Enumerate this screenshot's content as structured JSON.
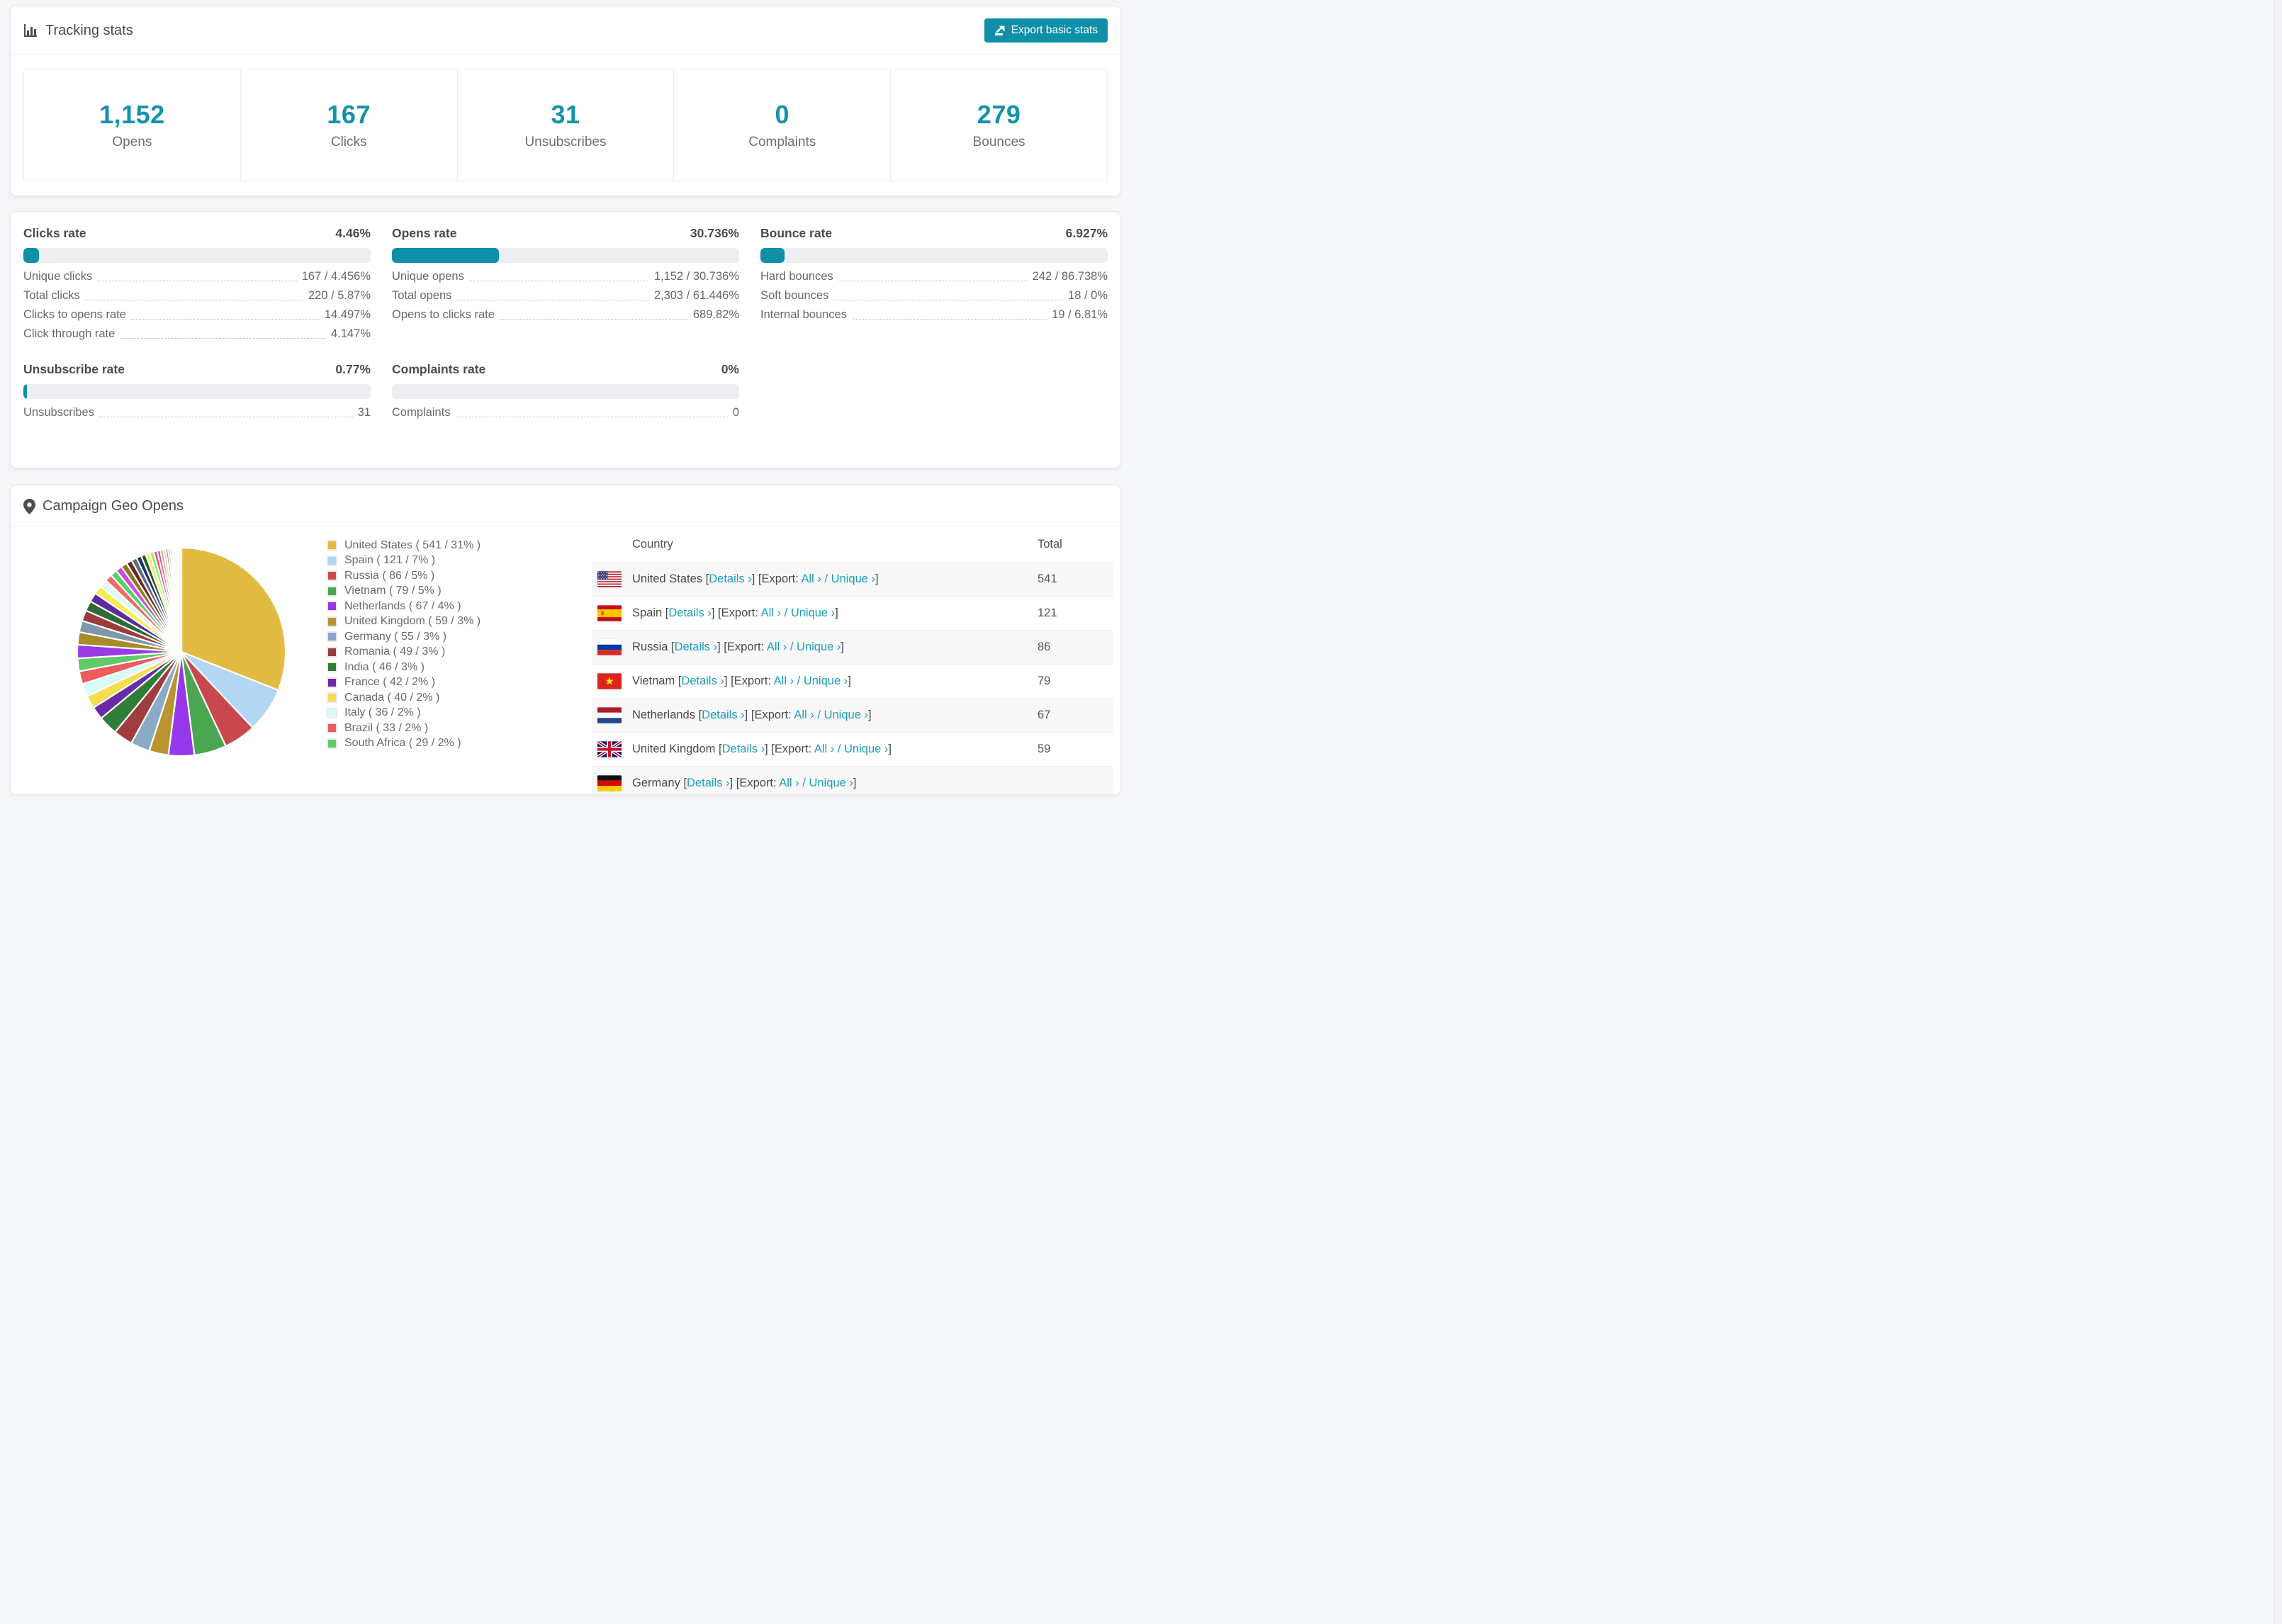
{
  "colors": {
    "accent": "#0f90a8",
    "link": "#1c9fb8",
    "bar_track": "#eceef1",
    "row_stripe": "#f8f8f8"
  },
  "tracking": {
    "title": "Tracking stats",
    "export_button": "Export basic stats",
    "stats": [
      {
        "value": "1,152",
        "label": "Opens"
      },
      {
        "value": "167",
        "label": "Clicks"
      },
      {
        "value": "31",
        "label": "Unsubscribes"
      },
      {
        "value": "0",
        "label": "Complaints"
      },
      {
        "value": "279",
        "label": "Bounces"
      }
    ]
  },
  "rates": {
    "sections": [
      {
        "title": "Clicks rate",
        "value": "4.46%",
        "percent": 4.46,
        "rows": [
          {
            "label": "Unique clicks",
            "value": "167 / 4.456%"
          },
          {
            "label": "Total clicks",
            "value": "220 / 5.87%"
          },
          {
            "label": "Clicks to opens rate",
            "value": "14.497%"
          },
          {
            "label": "Click through rate",
            "value": "4.147%"
          }
        ]
      },
      {
        "title": "Opens rate",
        "value": "30.736%",
        "percent": 30.736,
        "rows": [
          {
            "label": "Unique opens",
            "value": "1,152 / 30.736%"
          },
          {
            "label": "Total opens",
            "value": "2,303 / 61.446%"
          },
          {
            "label": "Opens to clicks rate",
            "value": "689.82%"
          }
        ]
      },
      {
        "title": "Bounce rate",
        "value": "6.927%",
        "percent": 6.927,
        "rows": [
          {
            "label": "Hard bounces",
            "value": "242 / 86.738%"
          },
          {
            "label": "Soft bounces",
            "value": "18 / 0%"
          },
          {
            "label": "Internal bounces",
            "value": "19 / 6.81%"
          }
        ]
      },
      {
        "title": "Unsubscribe rate",
        "value": "0.77%",
        "percent": 0.77,
        "rows": [
          {
            "label": "Unsubscribes",
            "value": "31"
          }
        ]
      },
      {
        "title": "Complaints rate",
        "value": "0%",
        "percent": 0,
        "rows": [
          {
            "label": "Complaints",
            "value": "0"
          }
        ]
      }
    ]
  },
  "geo": {
    "title": "Campaign Geo Opens",
    "table": {
      "headers": [
        "Country",
        "Total"
      ],
      "link_labels": {
        "details": "Details ›",
        "export_prefix": "Export:",
        "all": "All ›",
        "slash": "/",
        "unique": "Unique ›"
      },
      "rows": [
        {
          "country": "United States",
          "flag": "us",
          "total": "541"
        },
        {
          "country": "Spain",
          "flag": "es",
          "total": "121"
        },
        {
          "country": "Russia",
          "flag": "ru",
          "total": "86"
        },
        {
          "country": "Vietnam",
          "flag": "vn",
          "total": "79"
        },
        {
          "country": "Netherlands",
          "flag": "nl",
          "total": "67"
        },
        {
          "country": "United Kingdom",
          "flag": "gb",
          "total": "59"
        },
        {
          "country": "Germany",
          "flag": "de",
          "total": ""
        }
      ]
    }
  },
  "chart_data": {
    "type": "pie",
    "title": "Campaign Geo Opens",
    "legend_position": "right",
    "start_angle_deg": -90,
    "direction": "clockwise",
    "slices": [
      {
        "label": "United States",
        "count": 541,
        "percent": 31,
        "color": "#e2bc42"
      },
      {
        "label": "Spain",
        "count": 121,
        "percent": 7,
        "color": "#b3d7f2"
      },
      {
        "label": "Russia",
        "count": 86,
        "percent": 5,
        "color": "#c7494d"
      },
      {
        "label": "Vietnam",
        "count": 79,
        "percent": 5,
        "color": "#4aa650"
      },
      {
        "label": "Netherlands",
        "count": 67,
        "percent": 4,
        "color": "#9538ea"
      },
      {
        "label": "United Kingdom",
        "count": 59,
        "percent": 3,
        "color": "#b8952e"
      },
      {
        "label": "Germany",
        "count": 55,
        "percent": 3,
        "color": "#8aa9c6"
      },
      {
        "label": "Romania",
        "count": 49,
        "percent": 3,
        "color": "#9d3d40"
      },
      {
        "label": "India",
        "count": 46,
        "percent": 3,
        "color": "#2e7d38"
      },
      {
        "label": "France",
        "count": 42,
        "percent": 2,
        "color": "#6a2aa8"
      },
      {
        "label": "Canada",
        "count": 40,
        "percent": 2,
        "color": "#f6dd4d"
      },
      {
        "label": "Italy",
        "count": 36,
        "percent": 2,
        "color": "#d8fbf9"
      },
      {
        "label": "Brazil",
        "count": 33,
        "percent": 2,
        "color": "#ef5a5c"
      },
      {
        "label": "South Africa",
        "count": 29,
        "percent": 2,
        "color": "#5ecb66"
      }
    ],
    "legend_text_format": "{label} ( {count} / {percent}% )",
    "unlabeled_slices": {
      "note": "many small unlabeled countries filling the remainder of the pie",
      "percent_total": 26,
      "values": [
        1.9,
        1.75,
        1.6,
        1.5,
        1.4,
        1.3,
        1.2,
        1.1,
        1.0,
        0.95,
        0.9,
        0.85,
        0.8,
        0.75,
        0.7,
        0.65,
        0.6,
        0.55,
        0.5,
        0.45,
        0.4,
        0.36,
        0.32,
        0.28,
        0.25,
        0.22,
        0.2,
        0.17,
        0.15,
        0.13,
        0.11,
        0.1,
        0.08,
        0.07,
        0.06,
        0.05
      ],
      "colors": [
        "#9a3be8",
        "#a88c2c",
        "#7f96ab",
        "#9c3b3b",
        "#2c6b34",
        "#5e2b9e",
        "#f4ee4e",
        "#dff9f6",
        "#f56868",
        "#55d16b",
        "#d24ae0",
        "#8a7a1e",
        "#6e2525",
        "#5a6b7d",
        "#252f6e",
        "#1c5b28",
        "#f7ef55",
        "#82f08e",
        "#f54d4d",
        "#c44df0",
        "#d4a92a",
        "#a8d4f5",
        "#e84c4c",
        "#3fa34d",
        "#8a2be2",
        "#caa21f",
        "#c6f7ef",
        "#f08080",
        "#7ddc5a",
        "#e05ae0",
        "#7a3bdb",
        "#9a8c20",
        "#6b7f94",
        "#e05252",
        "#4caf50",
        "#b05ce8"
      ]
    }
  }
}
